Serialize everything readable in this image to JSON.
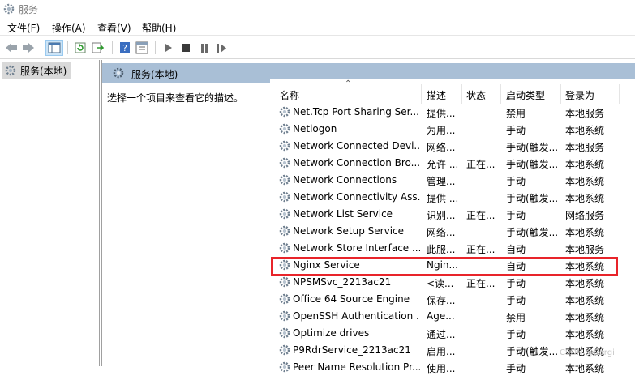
{
  "window": {
    "title": "服务"
  },
  "menu": [
    "文件(F)",
    "操作(A)",
    "查看(V)",
    "帮助(H)"
  ],
  "tree": {
    "item": "服务(本地)"
  },
  "pane": {
    "header": "服务(本地)",
    "description": "选择一个项目来查看它的描述。"
  },
  "columns": {
    "name": "名称",
    "desc": "描述",
    "status": "状态",
    "start": "启动类型",
    "logon": "登录为"
  },
  "services": [
    {
      "name": "Net.Tcp Port Sharing Ser...",
      "desc": "提供...",
      "status": "",
      "start": "禁用",
      "logon": "本地服务"
    },
    {
      "name": "Netlogon",
      "desc": "为用...",
      "status": "",
      "start": "手动",
      "logon": "本地系统"
    },
    {
      "name": "Network Connected Devi...",
      "desc": "网络...",
      "status": "",
      "start": "手动(触发...",
      "logon": "本地服务"
    },
    {
      "name": "Network Connection Bro...",
      "desc": "允许 ...",
      "status": "正在...",
      "start": "手动(触发...",
      "logon": "本地系统"
    },
    {
      "name": "Network Connections",
      "desc": "管理...",
      "status": "",
      "start": "手动",
      "logon": "本地系统"
    },
    {
      "name": "Network Connectivity Ass...",
      "desc": "提供 ...",
      "status": "",
      "start": "手动(触发...",
      "logon": "本地系统"
    },
    {
      "name": "Network List Service",
      "desc": "识别...",
      "status": "正在...",
      "start": "手动",
      "logon": "网络服务"
    },
    {
      "name": "Network Setup Service",
      "desc": "网络...",
      "status": "",
      "start": "手动(触发...",
      "logon": "本地系统"
    },
    {
      "name": "Network Store Interface ...",
      "desc": "此服...",
      "status": "正在...",
      "start": "自动",
      "logon": "本地服务"
    },
    {
      "name": "Nginx Service",
      "desc": "Ngin...",
      "status": "",
      "start": "自动",
      "logon": "本地系统"
    },
    {
      "name": "NPSMSvc_2213ac21",
      "desc": "<读...",
      "status": "正在...",
      "start": "手动",
      "logon": "本地系统"
    },
    {
      "name": "Office 64 Source Engine",
      "desc": "保存...",
      "status": "",
      "start": "手动",
      "logon": "本地系统"
    },
    {
      "name": "OpenSSH Authentication ...",
      "desc": "Age...",
      "status": "",
      "start": "禁用",
      "logon": "本地系统"
    },
    {
      "name": "Optimize drives",
      "desc": "通过...",
      "status": "",
      "start": "手动",
      "logon": "本地系统"
    },
    {
      "name": "P9RdrService_2213ac21",
      "desc": "启用...",
      "status": "",
      "start": "手动(触发...",
      "logon": "本地系统"
    },
    {
      "name": "Peer Name Resolution Pr...",
      "desc": "使用...",
      "status": "",
      "start": "手动",
      "logon": "本地系统"
    }
  ],
  "watermark": "CSDN @Corgi",
  "colors": {
    "header_bg": "#a9bfd6",
    "highlight": "#e8242a",
    "selected_tree": "#d9d9d9"
  }
}
